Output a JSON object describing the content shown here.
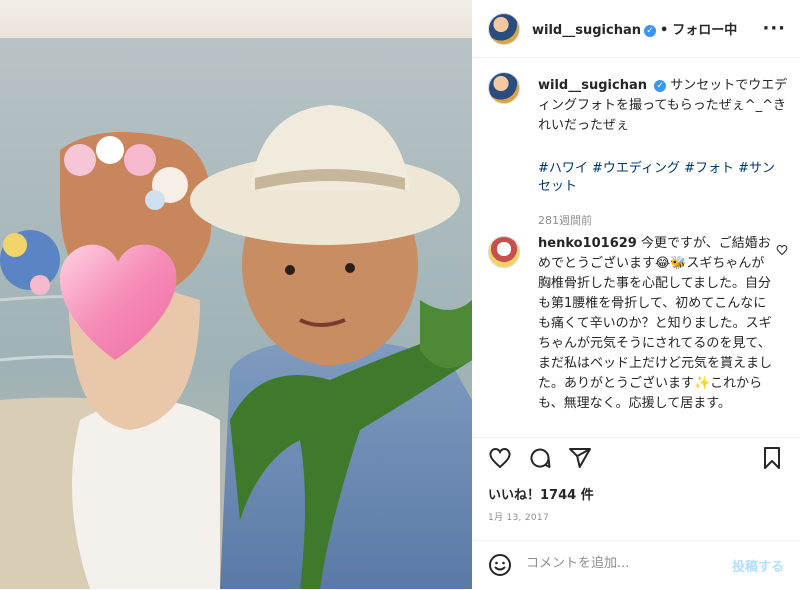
{
  "header": {
    "username": "wild__sugichan",
    "verified_glyph": "✓",
    "separator": "•",
    "follow_status": "フォロー中",
    "more_glyph": "···"
  },
  "caption": {
    "username": "wild__sugichan",
    "text": "サンセットでウエディングフォトを撮ってもらったぜぇ^_^きれいだったぜぇ",
    "hashtags": "#ハワイ #ウエディング #フォト #サンセット",
    "age": "281週間前"
  },
  "comment": {
    "username": "henko101629",
    "text": "今更ですが、ご結婚おめでとうございます😂🐝スギちゃんが胸椎骨折した事を心配してました。自分も第1腰椎を骨折して、初めてこんなにも痛くて辛いのか？と知りました。スギちゃんが元気そうにされてるのを見て、まだ私はベッド上だけど元気を貰えました。ありがとうございます✨これからも、無理なく。応援して居ます。"
  },
  "icons": {
    "like": "heart-icon",
    "comment": "comment-icon",
    "share": "share-icon",
    "save": "bookmark-icon",
    "emoji": "emoji-icon",
    "more": "more-icon"
  },
  "likes_text": "いいね！1744 件",
  "date": "1月 13, 2017",
  "add_comment": {
    "placeholder": "コメントを追加...",
    "post_label": "投稿する"
  },
  "colors": {
    "verified": "#3897f0",
    "hashtag": "#00376b",
    "post_disabled": "#b2dffc",
    "muted": "#8e8e8e"
  }
}
